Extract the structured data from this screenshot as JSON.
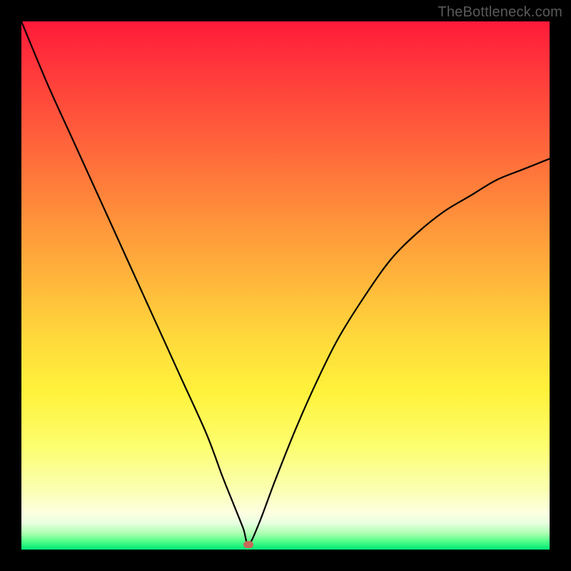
{
  "attribution": "TheBottleneck.com",
  "colors": {
    "frame": "#000000",
    "gradient_top": "#ff1a3a",
    "gradient_bottom": "#00e676",
    "curve": "#000000",
    "marker": "#c86a5a",
    "attribution_text": "#5a5a5a"
  },
  "chart_data": {
    "type": "line",
    "title": "",
    "xlabel": "",
    "ylabel": "",
    "xlim": [
      0,
      100
    ],
    "ylim": [
      0,
      100
    ],
    "grid": false,
    "legend": false,
    "marker": {
      "x": 43,
      "y": 1
    },
    "series": [
      {
        "name": "bottleneck-curve",
        "x": [
          0,
          5,
          10,
          15,
          20,
          25,
          30,
          35,
          38,
          40,
          42,
          43,
          45,
          48,
          52,
          56,
          60,
          65,
          70,
          75,
          80,
          85,
          90,
          95,
          100
        ],
        "y": [
          100,
          88,
          77,
          66,
          55,
          44,
          33,
          22,
          14,
          9,
          4,
          1,
          5,
          13,
          23,
          32,
          40,
          48,
          55,
          60,
          64,
          67,
          70,
          72,
          74
        ]
      }
    ]
  }
}
